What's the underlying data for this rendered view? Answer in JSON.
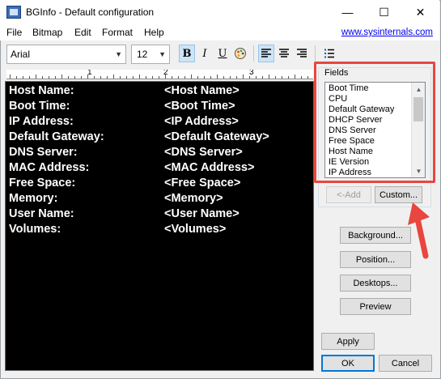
{
  "window": {
    "title": "BGInfo - Default configuration",
    "controls": [
      "—",
      "☐",
      "✕"
    ]
  },
  "menu": {
    "items": [
      "File",
      "Bitmap",
      "Edit",
      "Format",
      "Help"
    ],
    "link": "www.sysinternals.com"
  },
  "toolbar": {
    "font": "Arial",
    "size": "12",
    "bold": "B",
    "italic": "I",
    "underline": "U"
  },
  "ruler": {
    "numbers": [
      "1",
      "2",
      "3"
    ]
  },
  "editor": {
    "rows": [
      {
        "label": "Host Name:",
        "value": "<Host Name>"
      },
      {
        "label": "Boot Time:",
        "value": "<Boot Time>"
      },
      {
        "label": "IP Address:",
        "value": "<IP Address>"
      },
      {
        "label": "Default Gateway:",
        "value": "<Default Gateway>"
      },
      {
        "label": "DNS Server:",
        "value": "<DNS Server>"
      },
      {
        "label": "MAC Address:",
        "value": "<MAC Address>"
      },
      {
        "label": "Free Space:",
        "value": "<Free Space>"
      },
      {
        "label": "Memory:",
        "value": "<Memory>"
      },
      {
        "label": "User Name:",
        "value": "<User Name>"
      },
      {
        "label": "Volumes:",
        "value": "<Volumes>"
      }
    ]
  },
  "fields": {
    "title": "Fields",
    "items": [
      "Boot Time",
      "CPU",
      "Default Gateway",
      "DHCP Server",
      "DNS Server",
      "Free Space",
      "Host Name",
      "IE Version",
      "IP Address"
    ]
  },
  "buttons": {
    "add": "<-Add",
    "custom": "Custom...",
    "background": "Background...",
    "position": "Position...",
    "desktops": "Desktops...",
    "preview": "Preview",
    "apply": "Apply",
    "ok": "OK",
    "cancel": "Cancel"
  },
  "colors": {
    "highlight": "#e8463f",
    "editor_bg": "#000000",
    "link": "#0000ee"
  }
}
